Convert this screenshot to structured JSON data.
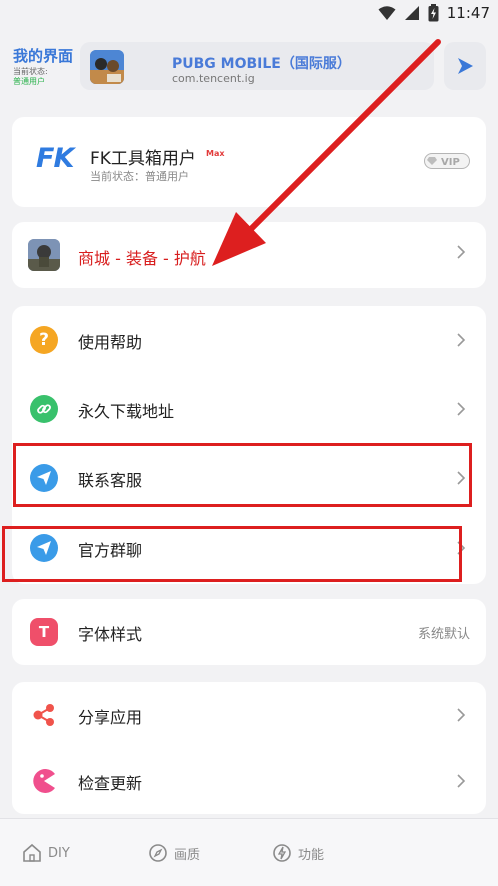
{
  "status_bar": {
    "time": "11:47"
  },
  "header": {
    "page_title": "我的界面",
    "status_label": "当前状态:",
    "status_value": "普通用户",
    "game": {
      "name": "PUBG MOBILE（国际服）",
      "package": "com.tencent.ig"
    }
  },
  "profile": {
    "logo_text": "FK",
    "name": "FK工具箱用户",
    "badge": "Max",
    "status": "当前状态：普通用户",
    "vip_label": "VIP"
  },
  "shop": {
    "label": "商城 - 装备 - 护航"
  },
  "menu": {
    "help": "使用帮助",
    "download": "永久下载地址",
    "contact": "联系客服",
    "group": "官方群聊"
  },
  "font": {
    "label": "字体样式",
    "value": "系统默认"
  },
  "more": {
    "share": "分享应用",
    "update": "检查更新"
  },
  "tabs": [
    {
      "label": "DIY"
    },
    {
      "label": "画质"
    },
    {
      "label": "功能"
    }
  ],
  "colors": {
    "accent_blue": "#3a78d8",
    "highlight_red": "#dd1f1f",
    "help_icon": "#f5a623",
    "link_icon": "#39c16c",
    "telegram_icon": "#3a9be8",
    "font_icon": "#ef4f6a",
    "share_icon": "#f0534b",
    "update_icon": "#f04f8d"
  }
}
